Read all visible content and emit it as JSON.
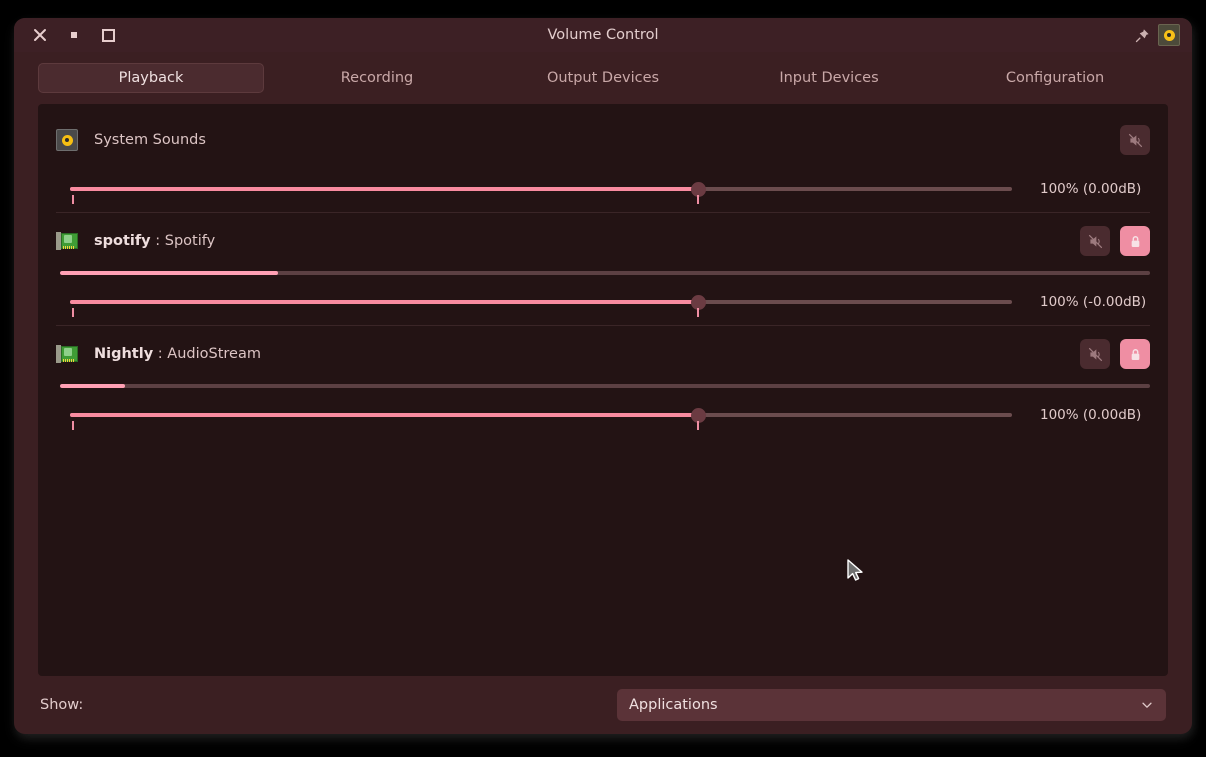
{
  "window": {
    "title": "Volume Control",
    "controls": {
      "close": "close-window",
      "minimize": "minimize-window",
      "maximize": "maximize-window",
      "pin": "always-on-top",
      "tray_icon": "volume-icon"
    }
  },
  "tabs": [
    {
      "label": "Playback",
      "active": true
    },
    {
      "label": "Recording",
      "active": false
    },
    {
      "label": "Output Devices",
      "active": false
    },
    {
      "label": "Input Devices",
      "active": false
    },
    {
      "label": "Configuration",
      "active": false
    }
  ],
  "streams": [
    {
      "icon": "speaker-icon",
      "name": "System Sounds",
      "app": "",
      "has_meter": false,
      "meter_percent": 0,
      "volume_label": "100% (0.00dB)",
      "volume_percent": 65,
      "mute_button": {
        "label": "Mute audio",
        "active": false
      },
      "lock_button": null
    },
    {
      "icon": "soundcard-icon",
      "name": "spotify",
      "app": ": Spotify",
      "has_meter": true,
      "meter_percent": 20,
      "volume_label": "100% (-0.00dB)",
      "volume_percent": 65,
      "mute_button": {
        "label": "Mute audio",
        "active": false
      },
      "lock_button": {
        "label": "Lock channels together",
        "active": true
      }
    },
    {
      "icon": "soundcard-icon",
      "name": "Nightly",
      "app": ": AudioStream",
      "has_meter": true,
      "meter_percent": 6,
      "volume_label": "100% (0.00dB)",
      "volume_percent": 65,
      "mute_button": {
        "label": "Mute audio",
        "active": false
      },
      "lock_button": {
        "label": "Lock channels together",
        "active": true
      }
    }
  ],
  "footer": {
    "show_label": "Show:",
    "filter_value": "Applications"
  },
  "colors": {
    "window_bg": "#3b1f22",
    "content_bg": "#231314",
    "accent_pink": "#f98ba0",
    "accent_light": "#ffa0b4",
    "tab_active_bg": "#4b2b2f",
    "text": "#e2cccc"
  }
}
